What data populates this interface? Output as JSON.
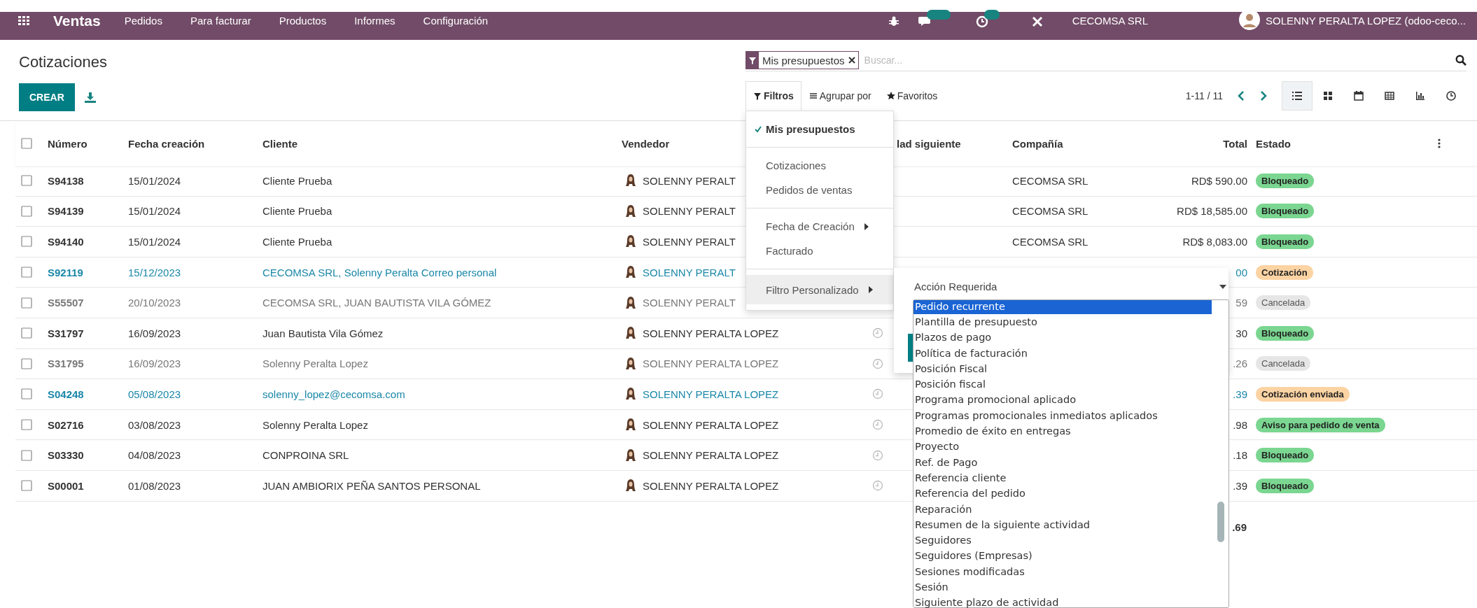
{
  "topbar": {
    "app": "Ventas",
    "menu": [
      "Pedidos",
      "Para facturar",
      "Productos",
      "Informes",
      "Configuración"
    ],
    "company": "CECOMSA SRL",
    "user": "SOLENNY PERALTA LOPEZ (odoo-ceco..."
  },
  "title": "Cotizaciones",
  "create_button": "CREAR",
  "search": {
    "facet": "Mis presupuestos",
    "placeholder": "Buscar..."
  },
  "search_menus": [
    {
      "label": "Filtros",
      "selected": true
    },
    {
      "label": "Agrupar por",
      "selected": false
    },
    {
      "label": "Favoritos",
      "selected": false
    }
  ],
  "pager": "1-11 / 11",
  "views": [
    {
      "kind": "list",
      "selected": true
    },
    {
      "kind": "kanban",
      "selected": false
    },
    {
      "kind": "calendar",
      "selected": false
    },
    {
      "kind": "pivot",
      "selected": false
    },
    {
      "kind": "graph",
      "selected": false
    },
    {
      "kind": "activity",
      "selected": false
    }
  ],
  "table": {
    "select_all": false,
    "columns": [
      "Número",
      "Fecha creación",
      "Cliente",
      "Vendedor",
      "lad siguiente",
      "Compañía",
      "Total",
      "Estado"
    ],
    "rows": [
      {
        "kind": "normal",
        "checked": false,
        "number": "S94138",
        "date": "15/01/2024",
        "customer": "Cliente Prueba",
        "salesperson": "SOLENNY PERALT",
        "activity": false,
        "company": "CECOMSA SRL",
        "total": "RD$ 590.00",
        "status": {
          "label": "Bloqueado",
          "color": "#7ad690"
        }
      },
      {
        "kind": "normal",
        "checked": false,
        "number": "S94139",
        "date": "15/01/2024",
        "customer": "Cliente Prueba",
        "salesperson": "SOLENNY PERALT",
        "activity": false,
        "company": "CECOMSA SRL",
        "total": "RD$ 18,585.00",
        "status": {
          "label": "Bloqueado",
          "color": "#7ad690"
        }
      },
      {
        "kind": "normal",
        "checked": false,
        "number": "S94140",
        "date": "15/01/2024",
        "customer": "Cliente Prueba",
        "salesperson": "SOLENNY PERALT",
        "activity": false,
        "company": "CECOMSA SRL",
        "total": "RD$ 8,083.00",
        "status": {
          "label": "Bloqueado",
          "color": "#7ad690"
        }
      },
      {
        "kind": "link",
        "checked": false,
        "number": "S92119",
        "date": "15/12/2023",
        "customer": "CECOMSA SRL, Solenny Peralta Correo personal",
        "salesperson": "SOLENNY PERALT",
        "activity": false,
        "total": "00",
        "status": {
          "label": "Cotización",
          "color": "#fcd3a3"
        }
      },
      {
        "kind": "muted",
        "checked": false,
        "number": "S55507",
        "date": "20/10/2023",
        "customer": "CECOMSA SRL, JUAN BAUTISTA VILA GÓMEZ",
        "salesperson": "SOLENNY PERALT",
        "activity": false,
        "total": "59",
        "status": {
          "label": "Cancelada",
          "color": "#e6e6e6"
        }
      },
      {
        "kind": "normal",
        "checked": false,
        "number": "S31797",
        "date": "16/09/2023",
        "customer": "Juan Bautista Vila Gómez",
        "salesperson": "SOLENNY PERALTA LOPEZ",
        "activity": true,
        "total": "30",
        "status": {
          "label": "Bloqueado",
          "color": "#7ad690"
        }
      },
      {
        "kind": "muted",
        "checked": false,
        "number": "S31795",
        "date": "16/09/2023",
        "customer": "Solenny Peralta Lopez",
        "salesperson": "SOLENNY PERALTA LOPEZ",
        "activity": true,
        "total": ".26",
        "status": {
          "label": "Cancelada",
          "color": "#e6e6e6"
        }
      },
      {
        "kind": "link",
        "checked": false,
        "number": "S04248",
        "date": "05/08/2023",
        "customer": "solenny_lopez@cecomsa.com",
        "salesperson": "SOLENNY PERALTA LOPEZ",
        "activity": true,
        "total": ".39",
        "status": {
          "label": "Cotización enviada",
          "color": "#fcd3a3"
        }
      },
      {
        "kind": "normal",
        "checked": false,
        "number": "S02716",
        "date": "03/08/2023",
        "customer": "Solenny Peralta Lopez",
        "salesperson": "SOLENNY PERALTA LOPEZ",
        "activity": true,
        "total": ".98",
        "status": {
          "label": "Aviso para pedido de venta",
          "color": "#7ad690"
        }
      },
      {
        "kind": "normal",
        "checked": false,
        "number": "S03330",
        "date": "04/08/2023",
        "customer": "CONPROINA SRL",
        "salesperson": "SOLENNY PERALTA LOPEZ",
        "activity": true,
        "total": ".18",
        "status": {
          "label": "Bloqueado",
          "color": "#7ad690"
        }
      },
      {
        "kind": "normal",
        "checked": false,
        "number": "S00001",
        "date": "01/08/2023",
        "customer": "JUAN AMBIORIX PEÑA SANTOS PERSONAL",
        "salesperson": "SOLENNY PERALTA LOPEZ",
        "activity": true,
        "total": ".39",
        "status": {
          "label": "Bloqueado",
          "color": "#7ad690"
        }
      }
    ],
    "sum": ".69"
  },
  "filter_menu": {
    "groups": [
      [
        {
          "label": "Mis presupuestos",
          "checked": true,
          "submenu": false,
          "hovered": false
        }
      ],
      [
        {
          "label": "Cotizaciones",
          "checked": false,
          "submenu": false,
          "hovered": false
        },
        {
          "label": "Pedidos de ventas",
          "checked": false,
          "submenu": false,
          "hovered": false
        }
      ],
      [
        {
          "label": "Fecha de Creación",
          "checked": false,
          "submenu": true,
          "hovered": false
        },
        {
          "label": "Facturado",
          "checked": false,
          "submenu": false,
          "hovered": false
        }
      ],
      [
        {
          "label": "Filtro Personalizado",
          "checked": false,
          "submenu": true,
          "hovered": true
        }
      ]
    ]
  },
  "custom_filter": {
    "field": "Acción Requerida",
    "options": [
      {
        "label": "Pedido recurrente",
        "selected": true
      },
      {
        "label": "Plantilla de presupuesto",
        "selected": false
      },
      {
        "label": "Plazos de pago",
        "selected": false
      },
      {
        "label": "Política de facturación",
        "selected": false
      },
      {
        "label": "Posición Fiscal",
        "selected": false
      },
      {
        "label": "Posición fiscal",
        "selected": false
      },
      {
        "label": "Programa promocional aplicado",
        "selected": false
      },
      {
        "label": "Programas promocionales inmediatos aplicados",
        "selected": false
      },
      {
        "label": "Promedio de éxito en entregas",
        "selected": false
      },
      {
        "label": "Proyecto",
        "selected": false
      },
      {
        "label": "Ref. de Pago",
        "selected": false
      },
      {
        "label": "Referencia cliente",
        "selected": false
      },
      {
        "label": "Referencia del pedido",
        "selected": false
      },
      {
        "label": "Reparación",
        "selected": false
      },
      {
        "label": "Resumen de la siguiente actividad",
        "selected": false
      },
      {
        "label": "Seguidores",
        "selected": false
      },
      {
        "label": "Seguidores (Empresas)",
        "selected": false
      },
      {
        "label": "Sesiones modificadas",
        "selected": false
      },
      {
        "label": "Sesión",
        "selected": false
      },
      {
        "label": "Siguiente plazo de actividad",
        "selected": false
      }
    ]
  }
}
